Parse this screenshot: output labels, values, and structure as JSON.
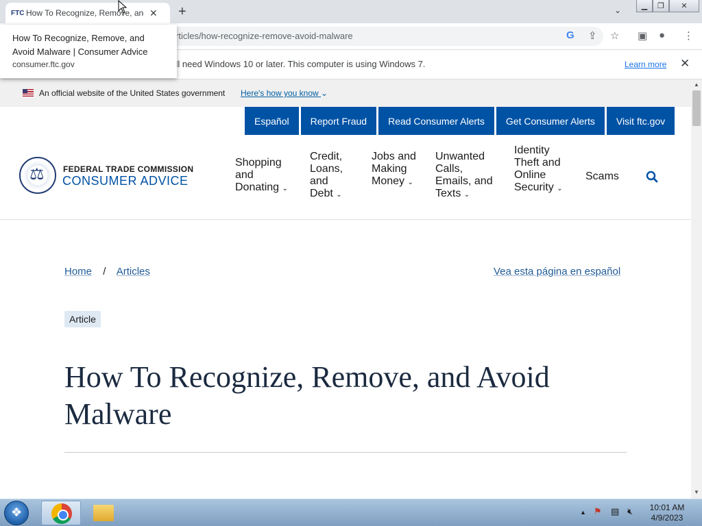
{
  "browser": {
    "tab": {
      "favicon_text": "FTC",
      "title": "How To Recognize, Remove, and Avoid Malware | Consumer Advice"
    },
    "new_tab": "+",
    "url": "consumer.ftc.gov/articles/how-recognize-remove-avoid-malware",
    "url_visible": "rticles/how-recognize-remove-avoid-malware",
    "infobar": {
      "message": "'ll need Windows 10 or later. This computer is using Windows 7.",
      "link": "Learn more"
    },
    "tooltip": {
      "line1": "How To Recognize, Remove, and Avoid Malware | Consumer Advice",
      "line2": "consumer.ftc.gov"
    }
  },
  "gov_banner": {
    "text": "An official website of the United States government",
    "link": "Here's how you know"
  },
  "top_buttons": [
    "Español",
    "Report Fraud",
    "Read Consumer Alerts",
    "Get Consumer Alerts",
    "Visit ftc.gov"
  ],
  "brand": {
    "agency": "FEDERAL TRADE COMMISSION",
    "site": "CONSUMER ADVICE"
  },
  "nav": [
    {
      "label": "Shopping and Donating"
    },
    {
      "label": "Credit, Loans, and Debt"
    },
    {
      "label": "Jobs and Making Money"
    },
    {
      "label": "Unwanted Calls, Emails, and Texts"
    },
    {
      "label": "Identity Theft and Online Security"
    },
    {
      "label": "Scams"
    }
  ],
  "breadcrumb": {
    "home": "Home",
    "separator": "/",
    "articles": "Articles",
    "spanish_link": "Vea esta página en español"
  },
  "badge": "Article",
  "article_title": "How To Recognize, Remove, and Avoid Malware",
  "taskbar": {
    "time": "10:01 AM",
    "date": "4/9/2023"
  }
}
